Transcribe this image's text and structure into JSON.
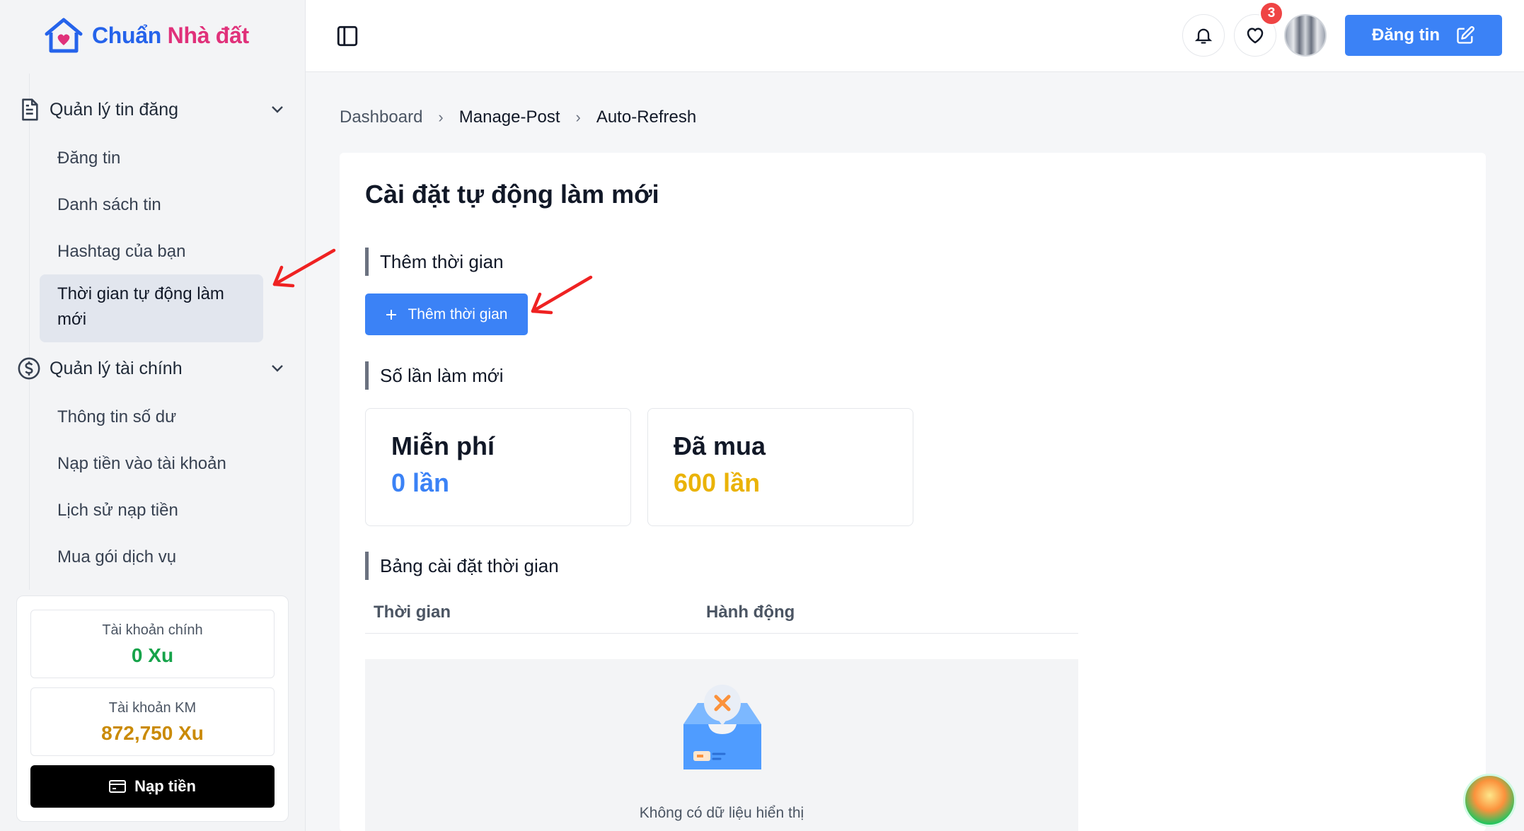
{
  "app": {
    "logo_part1": "Chuẩn",
    "logo_part2": "Nhà đất"
  },
  "sidebar": {
    "groups": [
      {
        "label": "Quản lý tin đăng",
        "items": [
          "Đăng tin",
          "Danh sách tin",
          "Hashtag của bạn",
          "Thời gian tự động làm mới"
        ]
      },
      {
        "label": "Quản lý tài chính",
        "items": [
          "Thông tin số dư",
          "Nạp tiền vào tài khoản",
          "Lịch sử nạp tiền",
          "Mua gói dịch vụ"
        ]
      }
    ],
    "active_item": "Thời gian tự động làm mới"
  },
  "wallet": {
    "main_label": "Tài khoản chính",
    "main_value": "0 Xu",
    "promo_label": "Tài khoản KM",
    "promo_value": "872,750 Xu",
    "topup_label": "Nạp tiền",
    "main_color": "#16a34a",
    "promo_color": "#ca8a04"
  },
  "topbar": {
    "favorites_count": "3",
    "post_button": "Đăng tin"
  },
  "breadcrumb": [
    "Dashboard",
    "Manage-Post",
    "Auto-Refresh"
  ],
  "main": {
    "title": "Cài đặt tự động làm mới",
    "add_time_section": "Thêm thời gian",
    "add_time_button": "Thêm thời gian",
    "refresh_count_section": "Số lần làm mới",
    "stats": [
      {
        "label": "Miễn phí",
        "value": "0 lần",
        "color": "#3b82f6"
      },
      {
        "label": "Đã mua",
        "value": "600 lần",
        "color": "#eab308"
      }
    ],
    "table_section": "Bảng cài đặt thời gian",
    "table_headers": [
      "Thời gian",
      "Hành động"
    ],
    "empty_text": "Không có dữ liệu hiển thị"
  },
  "colors": {
    "primary": "#3b82f6",
    "annotation_arrow": "#ef2222"
  }
}
